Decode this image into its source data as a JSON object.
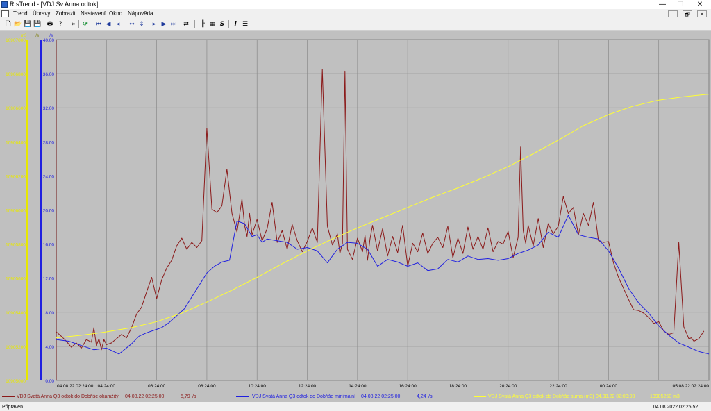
{
  "window": {
    "title": "RtsTrend - [VDJ Sv Anna odtok]",
    "buttons": {
      "minimize": "—",
      "restore": "❐",
      "close": "✕"
    }
  },
  "menu": {
    "items": [
      "Trend",
      "Úpravy",
      "Zobrazit",
      "Nastavení",
      "Okno",
      "Nápověda"
    ],
    "mdi_buttons": [
      "_",
      "🗗",
      "×"
    ]
  },
  "toolbar": {
    "icons": [
      {
        "name": "new-icon",
        "glyph": "🗋"
      },
      {
        "name": "open-icon",
        "glyph": "📂"
      },
      {
        "name": "save-icon",
        "glyph": "💾"
      },
      {
        "name": "save-as-icon",
        "glyph": "💾"
      },
      {
        "name": "print-icon",
        "glyph": "🖶"
      },
      {
        "name": "help-icon",
        "glyph": "?"
      },
      {
        "name": "overflow-icon",
        "glyph": "»"
      },
      {
        "name": "refresh-icon",
        "glyph": "⟳"
      },
      {
        "name": "first-icon",
        "glyph": "⏮"
      },
      {
        "name": "prev-page-icon",
        "glyph": "◀"
      },
      {
        "name": "prev-icon",
        "glyph": "◂"
      },
      {
        "name": "zoom-horizontal-icon",
        "glyph": "↔"
      },
      {
        "name": "zoom-vertical-icon",
        "glyph": "↕"
      },
      {
        "name": "next-icon",
        "glyph": "▸"
      },
      {
        "name": "next-page-icon",
        "glyph": "▶"
      },
      {
        "name": "last-icon",
        "glyph": "⏭"
      },
      {
        "name": "export-icon",
        "glyph": "⇄"
      },
      {
        "name": "chart-settings-icon",
        "glyph": "╠"
      },
      {
        "name": "table-icon",
        "glyph": "▦"
      },
      {
        "name": "script-icon",
        "glyph": "S"
      },
      {
        "name": "info-icon",
        "glyph": "i"
      },
      {
        "name": "list-icon",
        "glyph": "☰"
      }
    ]
  },
  "chart_data": {
    "type": "line",
    "axes": {
      "sum_axis": {
        "unit": "m3",
        "ticks": [
          "10905000",
          "10905200",
          "10905400",
          "10905600",
          "10905800",
          "10906000",
          "10906200",
          "10906400",
          "10906600",
          "10906800",
          "10907000"
        ],
        "color": "#e8e800"
      },
      "min_axis": {
        "unit": "l/s",
        "ticks": [
          "0.00",
          "4.00",
          "8.00",
          "12.00",
          "16.00",
          "20.00",
          "24.00",
          "28.00",
          "32.00",
          "36.00",
          "40.00"
        ],
        "color": "#0000ff"
      },
      "inst_axis": {
        "unit": "l/s",
        "ticks": [
          "0.00",
          "4.00",
          "8.00",
          "12.00",
          "16.00",
          "20.00",
          "24.00",
          "28.00",
          "32.00",
          "36.00",
          "40.00"
        ],
        "color": "#ffff00"
      },
      "x_ticks": [
        "04.08.22 02:24:00",
        "04:24:00",
        "06:24:00",
        "08:24:00",
        "10:24:00",
        "12:24:00",
        "14:24:00",
        "16:24:00",
        "18:24:00",
        "20:24:00",
        "22:24:00",
        "00:24:00",
        "05.08.22 02:24:00"
      ],
      "ylim": [
        0,
        40
      ],
      "grid": true
    },
    "series": [
      {
        "name": "VDJ Svatá Anna Q3 odtok do Dobřiše okamžitý",
        "color": "#8b1a1a",
        "x_hours": [
          0,
          0.2,
          0.4,
          0.6,
          0.8,
          1.0,
          1.2,
          1.4,
          1.5,
          1.6,
          1.7,
          1.8,
          1.9,
          2.0,
          2.2,
          2.4,
          2.6,
          2.8,
          3.0,
          3.2,
          3.4,
          3.6,
          3.8,
          4.0,
          4.2,
          4.4,
          4.6,
          4.8,
          5.0,
          5.2,
          5.4,
          5.6,
          5.8,
          6.0,
          6.2,
          6.4,
          6.6,
          6.8,
          7.0,
          7.2,
          7.4,
          7.5,
          7.6,
          7.7,
          7.8,
          8.0,
          8.2,
          8.4,
          8.6,
          8.8,
          9.0,
          9.2,
          9.4,
          9.6,
          9.8,
          10.0,
          10.2,
          10.4,
          10.6,
          10.8,
          11.0,
          11.2,
          11.3,
          11.4,
          11.5,
          11.6,
          11.8,
          12.0,
          12.2,
          12.3,
          12.4,
          12.5,
          12.6,
          12.8,
          13.0,
          13.2,
          13.4,
          13.6,
          13.8,
          14.0,
          14.2,
          14.4,
          14.6,
          14.8,
          15.0,
          15.2,
          15.4,
          15.6,
          15.8,
          16.0,
          16.2,
          16.4,
          16.6,
          16.8,
          17.0,
          17.2,
          17.4,
          17.6,
          17.8,
          18.0,
          18.2,
          18.4,
          18.5,
          18.6,
          18.7,
          18.8,
          19.0,
          19.2,
          19.4,
          19.6,
          19.8,
          20.0,
          20.2,
          20.4,
          20.6,
          20.8,
          21.0,
          21.2,
          21.4,
          21.6,
          21.8,
          22.0,
          22.2,
          22.4,
          22.6,
          22.8,
          23.0,
          23.2,
          23.4,
          23.6,
          23.8,
          24.0,
          24.2,
          24.4,
          24.6,
          24.8,
          25.0,
          25.1,
          25.2,
          25.3,
          25.4,
          25.6,
          25.8,
          26.0
        ],
        "values": [
          5.7,
          5.2,
          4.6,
          3.9,
          4.4,
          3.8,
          4.8,
          4.5,
          6.2,
          4.1,
          4.9,
          3.6,
          4.8,
          4.2,
          4.4,
          4.9,
          5.4,
          5.0,
          6.2,
          7.8,
          8.6,
          10.4,
          12.1,
          9.6,
          11.8,
          13.2,
          14.1,
          15.8,
          16.7,
          15.4,
          16.2,
          15.6,
          16.4,
          29.6,
          20.1,
          19.7,
          20.5,
          24.8,
          19.6,
          17.4,
          21.3,
          18.2,
          16.9,
          19.6,
          17.1,
          18.9,
          16.4,
          17.8,
          20.9,
          16.2,
          17.6,
          15.4,
          18.3,
          16.4,
          15.1,
          16.3,
          17.9,
          16.2,
          36.5,
          18.1,
          15.9,
          17.2,
          14.9,
          16.1,
          36.3,
          15.4,
          14.2,
          16.7,
          15.1,
          17.0,
          14.1,
          16.6,
          18.2,
          15.2,
          17.8,
          14.6,
          16.9,
          15.0,
          18.2,
          13.4,
          16.1,
          15.1,
          17.3,
          14.9,
          16.1,
          16.8,
          15.6,
          18.1,
          14.4,
          16.7,
          14.9,
          18.0,
          15.4,
          16.9,
          15.4,
          17.9,
          15.1,
          16.3,
          16.0,
          17.5,
          14.4,
          16.8,
          27.4,
          17.6,
          16.1,
          18.2,
          15.8,
          19.0,
          15.6,
          18.4,
          17.2,
          18.1,
          21.6,
          19.6,
          20.3,
          17.1,
          19.6,
          18.2,
          20.9,
          16.4,
          16.2,
          16.3,
          13.8,
          12.1,
          10.8,
          9.5,
          8.3,
          8.2,
          7.9,
          7.4,
          6.7,
          6.9,
          5.8,
          5.4,
          5.6,
          16.2,
          6.3,
          5.6,
          4.9,
          5.0,
          4.6,
          4.9,
          5.8
        ]
      },
      {
        "name": "VDJ Svatá Anna Q3 odtok do Dobřiše minimální",
        "color": "#2020e0",
        "x_hours": [
          0,
          0.5,
          1.0,
          1.5,
          2.0,
          2.5,
          3.0,
          3.3,
          3.6,
          3.9,
          4.2,
          4.5,
          4.8,
          5.1,
          5.4,
          5.7,
          6.0,
          6.3,
          6.6,
          6.9,
          7.2,
          7.5,
          7.8,
          8.0,
          8.2,
          8.4,
          8.8,
          9.2,
          9.6,
          10.0,
          10.4,
          10.8,
          11.2,
          11.6,
          12.0,
          12.4,
          12.8,
          13.2,
          13.6,
          14.0,
          14.4,
          14.8,
          15.2,
          15.6,
          16.0,
          16.4,
          16.8,
          17.2,
          17.6,
          18.0,
          18.4,
          18.8,
          19.2,
          19.6,
          20.0,
          20.4,
          20.8,
          21.2,
          21.6,
          22.0,
          22.4,
          22.8,
          23.2,
          23.6,
          24.0,
          24.4,
          24.8,
          25.2,
          25.6,
          26.0
        ],
        "values": [
          4.8,
          4.6,
          4.1,
          3.6,
          3.8,
          3.1,
          4.3,
          5.2,
          5.6,
          5.9,
          6.2,
          6.8,
          7.6,
          8.4,
          9.8,
          11.2,
          12.6,
          13.4,
          13.9,
          14.1,
          18.7,
          18.4,
          16.9,
          17.1,
          16.2,
          16.6,
          16.4,
          16.2,
          15.4,
          15.6,
          15.2,
          13.8,
          15.4,
          16.2,
          16.1,
          15.4,
          13.4,
          14.2,
          13.9,
          13.4,
          13.8,
          12.9,
          13.1,
          14.2,
          13.9,
          14.6,
          14.2,
          14.3,
          14.1,
          14.3,
          14.9,
          15.3,
          15.9,
          17.4,
          16.8,
          19.4,
          17.1,
          16.8,
          16.6,
          15.2,
          13.2,
          10.8,
          9.1,
          7.9,
          6.4,
          5.3,
          4.4,
          3.9,
          3.4,
          3.1
        ]
      },
      {
        "name": "VDJ Svatá Anna Q3 odtok do Dobřiše suma (m3)",
        "color": "#ffff33",
        "x_hours": [
          0,
          1,
          2,
          3,
          4,
          5,
          6,
          7,
          8,
          9,
          10,
          11,
          12,
          13,
          14,
          15,
          16,
          17,
          18,
          19,
          20,
          21,
          22,
          23,
          24,
          25,
          26
        ],
        "values": [
          10905250,
          10905265,
          10905285,
          10905310,
          10905345,
          10905395,
          10905460,
          10905530,
          10905605,
          10905685,
          10905760,
          10905830,
          10905895,
          10905955,
          10906015,
          10906075,
          10906130,
          10906190,
          10906255,
          10906330,
          10906410,
          10906495,
          10906560,
          10906610,
          10906645,
          10906665,
          10906680
        ]
      }
    ]
  },
  "legend": {
    "series1": {
      "name": "VDJ Svatá Anna Q3 odtok do Dobřiše okamžitý",
      "time": "04.08.22 02:25:00",
      "value": "5,79 l/s",
      "color": "#8b1a1a"
    },
    "series2": {
      "name": "VDJ Svatá Anna Q3 odtok do Dobřiše minimální",
      "time": "04.08.22 02:25:00",
      "value": "4,24 l/s",
      "color": "#2020e0"
    },
    "series3": {
      "name": "VDJ Svatá Anna Q3 odtok do Dobřiše suma (m3)",
      "time": "04.08.22 02:00:00",
      "value": "10905250 m3",
      "color": "#ffff33"
    }
  },
  "status": {
    "left": "Připraven",
    "right": "04.08.2022 02:25:52"
  }
}
